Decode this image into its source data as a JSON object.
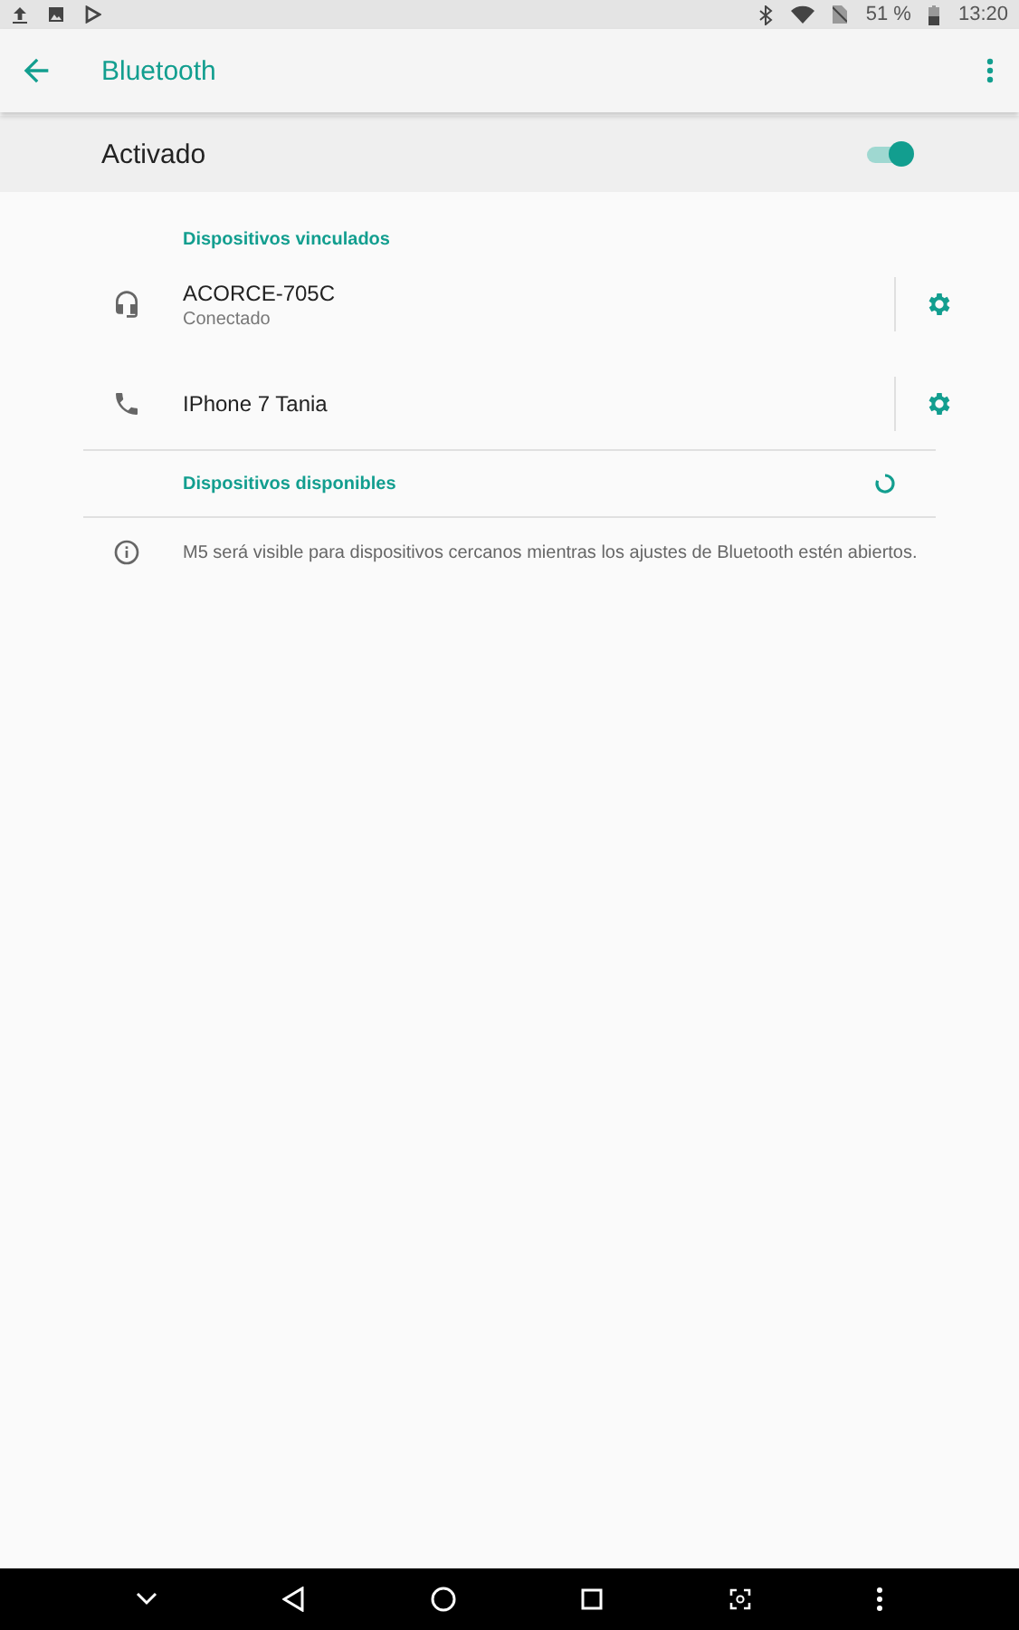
{
  "status_bar": {
    "battery": "51 %",
    "time": "13:20"
  },
  "app_bar": {
    "title": "Bluetooth"
  },
  "master_switch": {
    "label": "Activado",
    "on": true
  },
  "paired": {
    "header": "Dispositivos vinculados",
    "devices": [
      {
        "kind": "headphones",
        "name": "ACORCE-705C",
        "status": "Conectado"
      },
      {
        "kind": "phone",
        "name": "IPhone 7 Tania"
      }
    ]
  },
  "available": {
    "header": "Dispositivos disponibles",
    "scanning": true
  },
  "info": "M5 será visible para dispositivos cercanos mientras los ajustes de Bluetooth estén abiertos."
}
